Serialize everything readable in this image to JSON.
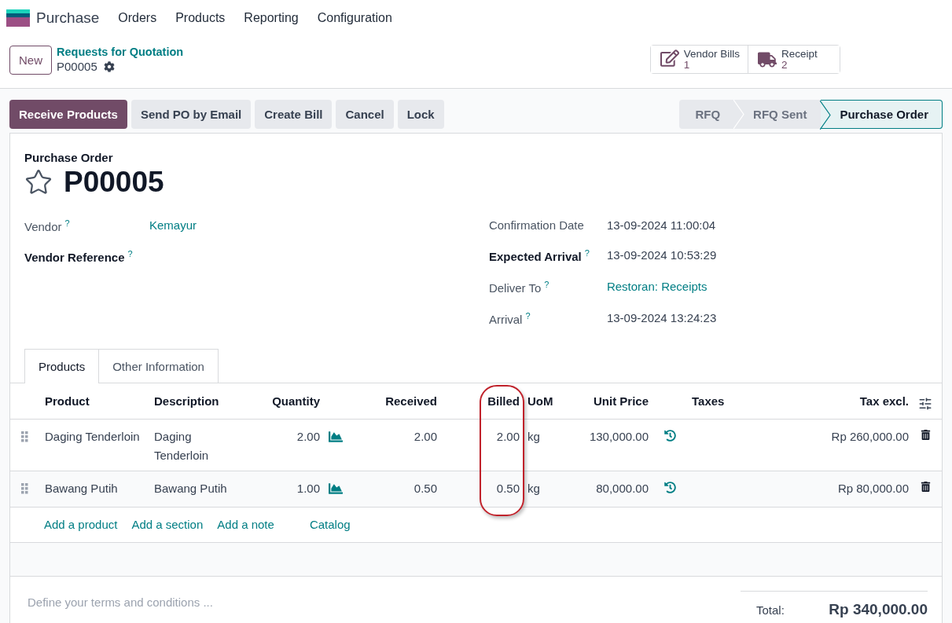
{
  "navbar": {
    "app": "Purchase",
    "menu": [
      "Orders",
      "Products",
      "Reporting",
      "Configuration"
    ]
  },
  "control_panel": {
    "new_button": "New",
    "breadcrumb": "Requests for Quotation",
    "record": "P00005",
    "stat_buttons": [
      {
        "kind": "bills",
        "label": "Vendor Bills",
        "count": "1"
      },
      {
        "kind": "receipt",
        "label": "Receipt",
        "count": "2"
      }
    ]
  },
  "actions": [
    {
      "label": "Receive Products",
      "primary": true
    },
    {
      "label": "Send PO by Email",
      "primary": false
    },
    {
      "label": "Create Bill",
      "primary": false
    },
    {
      "label": "Cancel",
      "primary": false
    },
    {
      "label": "Lock",
      "primary": false
    }
  ],
  "status_steps": [
    {
      "label": "RFQ",
      "selected": false
    },
    {
      "label": "RFQ Sent",
      "selected": false
    },
    {
      "label": "Purchase Order",
      "selected": true
    }
  ],
  "sheet": {
    "subtitle": "Purchase Order",
    "title": "P00005",
    "favorite": false
  },
  "left_fields": [
    {
      "label": "Vendor",
      "help": "?",
      "value": "Kemayur",
      "required": false,
      "link": true
    },
    {
      "label": "Vendor Reference",
      "help": "?",
      "required": true
    }
  ],
  "right_fields": [
    {
      "label": "Confirmation Date",
      "value": "13-09-2024 11:00:04",
      "required": false,
      "link": false
    },
    {
      "label": "Expected Arrival",
      "help": "?",
      "value": "13-09-2024 10:53:29",
      "required": true,
      "link": false
    },
    {
      "label": "Deliver To",
      "help": "?",
      "value": "Restoran: Receipts",
      "required": false,
      "link": true
    },
    {
      "label": "Arrival",
      "help": "?",
      "value": "13-09-2024 13:24:23",
      "required": false,
      "link": false
    }
  ],
  "tabs": [
    {
      "label": "Products",
      "selected": true
    },
    {
      "label": "Other Information",
      "selected": false
    }
  ],
  "table": {
    "columns": [
      "Product",
      "Description",
      "Quantity",
      "Received",
      "Billed",
      "UoM",
      "Unit Price",
      "Taxes",
      "Tax excl."
    ],
    "rows": [
      {
        "product": "Daging Tenderloin",
        "description": "Daging Tenderloin",
        "quantity": "2.00",
        "received": "2.00",
        "billed": "2.00",
        "uom": "kg",
        "unit_price": "130,000.00",
        "subtotal": "Rp 260,000.00"
      },
      {
        "product": "Bawang Putih",
        "description": "Bawang Putih",
        "quantity": "1.00",
        "received": "0.50",
        "billed": "0.50",
        "uom": "kg",
        "unit_price": "80,000.00",
        "subtotal": "Rp 80,000.00"
      }
    ],
    "add_links": [
      "Add a product",
      "Add a section",
      "Add a note",
      "Catalog"
    ]
  },
  "terms": {
    "placeholder": "Define your terms and conditions ..."
  },
  "total": {
    "label": "Total:",
    "value": "Rp 340,000.00"
  }
}
